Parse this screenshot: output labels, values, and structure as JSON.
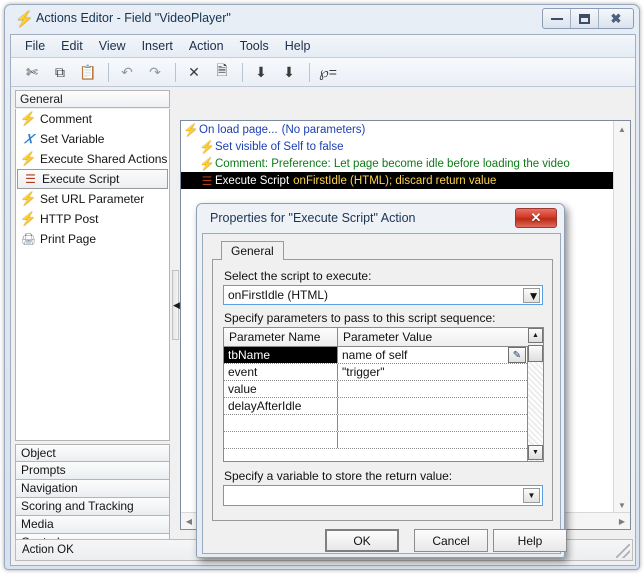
{
  "window": {
    "title": "Actions Editor - Field \"VideoPlayer\"",
    "icon": "lightning-bolt-icon",
    "caption_buttons": {
      "minimize": "minimize-icon",
      "maximize": "maximize-icon",
      "close": "close-icon"
    }
  },
  "menu": {
    "items": [
      "File",
      "Edit",
      "View",
      "Insert",
      "Action",
      "Tools",
      "Help"
    ]
  },
  "toolbar": {
    "buttons": [
      {
        "name": "cut-icon",
        "glyph": "✂"
      },
      {
        "name": "copy-icon",
        "glyph": "⧉"
      },
      {
        "name": "paste-icon",
        "glyph": "ὌB"
      },
      {
        "name": "undo-icon",
        "glyph": "↶"
      },
      {
        "name": "redo-icon",
        "glyph": "↷"
      },
      {
        "name": "delete-icon",
        "glyph": "✕"
      },
      {
        "name": "properties-icon",
        "glyph": "Ὕ2"
      },
      {
        "name": "move-up-icon",
        "glyph": "⬆"
      },
      {
        "name": "move-down-icon",
        "glyph": "⬇"
      },
      {
        "name": "variables-icon",
        "glyph": "℘"
      }
    ]
  },
  "left_panel": {
    "header": "General",
    "actions": [
      {
        "label": "Comment",
        "icon": "lightning-bolt-icon",
        "selected": false
      },
      {
        "label": "Set Variable",
        "icon": "variable-x-icon",
        "selected": false
      },
      {
        "label": "Execute Shared Actions",
        "icon": "lightning-bolt-icon",
        "selected": false
      },
      {
        "label": "Execute Script",
        "icon": "script-icon",
        "selected": true
      },
      {
        "label": "Set URL Parameter",
        "icon": "lightning-bolt-icon",
        "selected": false
      },
      {
        "label": "HTTP Post",
        "icon": "lightning-bolt-icon",
        "selected": false
      },
      {
        "label": "Print Page",
        "icon": "printer-icon",
        "selected": false
      }
    ],
    "categories": [
      "Object",
      "Prompts",
      "Navigation",
      "Scoring and Tracking",
      "Media",
      "Control"
    ]
  },
  "action_list": {
    "rows": [
      {
        "indent": 0,
        "icon": "lightning-bolt-icon",
        "text1": "On load page...",
        "text2": "(No parameters)",
        "style": "blue",
        "selected": false
      },
      {
        "indent": 1,
        "icon": "lightning-bolt-icon",
        "text1": "Set visible of Self to false",
        "text2": "",
        "style": "blue",
        "selected": false
      },
      {
        "indent": 1,
        "icon": "lightning-bolt-icon",
        "text1": "Comment: Preference: Let page become idle before loading the video",
        "text2": "",
        "style": "green",
        "selected": false
      },
      {
        "indent": 1,
        "icon": "script-icon",
        "text1": "Execute Script",
        "text2": "onFirstIdle (HTML); discard return value",
        "style": "selected",
        "selected": true
      }
    ]
  },
  "status_bar": {
    "text": "Action OK"
  },
  "dialog": {
    "title": "Properties for \"Execute Script\" Action",
    "close_label": "✕",
    "tab": "General",
    "script_label": "Select the script to execute:",
    "script_value": "onFirstIdle (HTML)",
    "params_label": "Specify parameters to pass to this script sequence:",
    "grid": {
      "columns": [
        "Parameter Name",
        "Parameter Value"
      ],
      "rows": [
        {
          "name": "tbName",
          "value": "name of self",
          "selected": true,
          "has_edit_button": true
        },
        {
          "name": "event",
          "value": "\"trigger\"",
          "selected": false,
          "has_edit_button": false
        },
        {
          "name": "value",
          "value": "",
          "selected": false,
          "has_edit_button": false
        },
        {
          "name": "delayAfterIdle",
          "value": "",
          "selected": false,
          "has_edit_button": false
        },
        {
          "name": "",
          "value": "",
          "selected": false,
          "has_edit_button": false
        },
        {
          "name": "",
          "value": "",
          "selected": false,
          "has_edit_button": false
        }
      ]
    },
    "retvar_label": "Specify a variable to store the return value:",
    "retvar_value": "",
    "buttons": {
      "ok": "OK",
      "cancel": "Cancel",
      "help": "Help"
    }
  },
  "colors": {
    "selection_bg": "#000000",
    "selection_fg": "#ffffff",
    "selection_accent": "#ffd34d",
    "link_blue": "#1c3fb0",
    "comment_green": "#0f7a18",
    "close_red": "#d03a28",
    "focus_border": "#5aa0e0"
  }
}
